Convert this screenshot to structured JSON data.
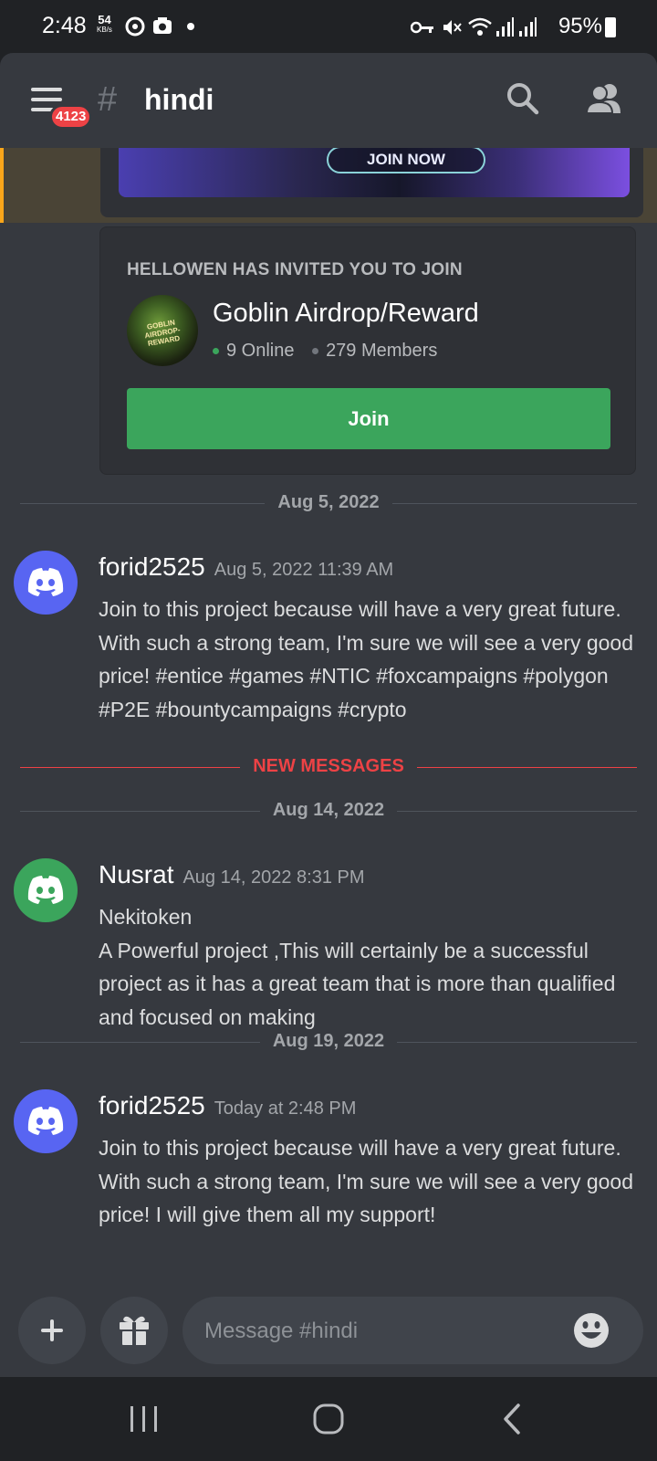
{
  "status_bar": {
    "time": "2:48",
    "net_speed": "54",
    "net_unit": "KB/s",
    "battery": "95%"
  },
  "header": {
    "unread_badge": "4123",
    "channel_hash": "#",
    "channel_name": "hindi"
  },
  "embed_preview": {
    "button_label": "JOIN NOW"
  },
  "invite": {
    "heading": "HELLOWEN HAS INVITED YOU TO JOIN",
    "guild_icon_text": "GOBLIN AIRDROP-REWARD",
    "guild_name": "Goblin Airdrop/Reward",
    "online": "9 Online",
    "members": "279 Members",
    "join_label": "Join",
    "online_color": "#3ba55c"
  },
  "dividers": {
    "d1": "Aug 5, 2022",
    "new_messages": "NEW MESSAGES",
    "d2": "Aug 14, 2022",
    "d3": "Aug 19, 2022"
  },
  "messages": [
    {
      "author": "forid2525",
      "time": "Aug 5, 2022 11:39 AM",
      "text": "Join to this project because will have a very great future. With such a strong team, I'm sure we will see a very good price! #entice #games #NTIC #foxcampaigns #polygon #P2E #bountycampaigns #crypto",
      "avatar_color": "#5865f2"
    },
    {
      "author": "Nusrat",
      "time": "Aug 14, 2022 8:31 PM",
      "text_line1": "Nekitoken",
      "text_line2": "A Powerful project ,This will certainly be a successful project as it has a great team that is more than qualified and focused on making",
      "avatar_color": "#3ba55c"
    },
    {
      "author": "forid2525",
      "time": "Today at 2:48 PM",
      "text": "Join to this project because will have a very great future. With such a strong team, I'm sure we will see a very good price! I will give them all my support!",
      "avatar_color": "#5865f2"
    }
  ],
  "composer": {
    "placeholder": "Message #hindi"
  },
  "icons": {
    "menu": "hamburger-icon",
    "search": "search-icon",
    "members": "members-icon",
    "add": "plus-icon",
    "gift": "gift-icon",
    "emoji": "emoji-icon",
    "nav_recent": "recent-apps-icon",
    "nav_home": "home-icon",
    "nav_back": "back-icon"
  },
  "colors": {
    "accent": "#5865f2",
    "danger": "#ed4245",
    "success": "#3ba55c",
    "highlight_bar": "#faa61a"
  }
}
